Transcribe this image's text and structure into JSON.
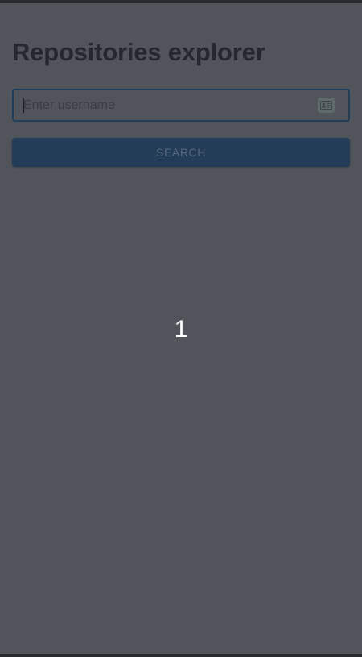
{
  "header": {
    "title": "Repositories explorer"
  },
  "search": {
    "placeholder": "Enter username",
    "value": "",
    "field_icon": "contact-card-icon",
    "button_label": "SEARCH"
  },
  "main": {
    "counter_text": "1"
  },
  "colors": {
    "background": "#51545b",
    "outer_bar": "#2a2c31",
    "title": "#25282e",
    "field_border": "#1f3f5c",
    "button_bg": "#233d58",
    "button_text": "#55687c",
    "counter": "#ffffff"
  }
}
